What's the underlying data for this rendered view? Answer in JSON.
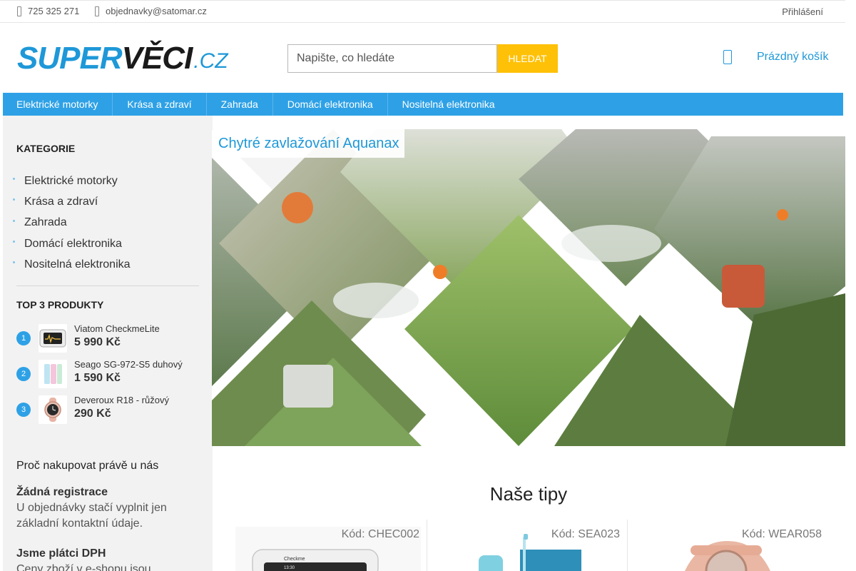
{
  "topbar": {
    "phone": "725 325 271",
    "email": "objednavky@satomar.cz",
    "login": "Přihlášení"
  },
  "logo": {
    "part1": "SUPER",
    "part2": "VĚCI",
    "part3": ".CZ"
  },
  "search": {
    "placeholder": "Napište, co hledáte",
    "button": "Hledat"
  },
  "cart": {
    "label": "Prázdný košík",
    "icon": "cart-icon"
  },
  "nav": {
    "items": [
      {
        "label": "Elektrické motorky"
      },
      {
        "label": "Krása a zdraví"
      },
      {
        "label": "Zahrada"
      },
      {
        "label": "Domácí elektronika"
      },
      {
        "label": "Nositelná elektronika"
      }
    ]
  },
  "sidebar": {
    "categories_title": "Kategorie",
    "categories": [
      {
        "label": "Elektrické motorky"
      },
      {
        "label": "Krása a zdraví"
      },
      {
        "label": "Zahrada"
      },
      {
        "label": "Domácí elektronika"
      },
      {
        "label": "Nositelná elektronika"
      }
    ],
    "top_title": "TOP 3 produkty",
    "top": [
      {
        "rank": "1",
        "name": "Viatom CheckmeLite",
        "price": "5 990 Kč"
      },
      {
        "rank": "2",
        "name": "Seago SG-972-S5 duhový",
        "price": "1 590 Kč"
      },
      {
        "rank": "3",
        "name": "Deveroux R18 - růžový",
        "price": "290 Kč"
      }
    ],
    "why_title": "Proč nakupovat právě u nás",
    "why": [
      {
        "heading": "Žádná registrace",
        "text": "U objednávky stačí vyplnit jen základní kontaktní údaje."
      },
      {
        "heading": "Jsme plátci DPH",
        "text": "Ceny zboží v e-shopu jsou"
      }
    ]
  },
  "banner": {
    "caption": "Chytré zavlažování Aquanax"
  },
  "tips": {
    "title": "Naše tipy",
    "products": [
      {
        "code": "Kód: CHEC002",
        "screen_text": "Checkme",
        "screen_time": "13:30"
      },
      {
        "code": "Kód: SEA023"
      },
      {
        "code": "Kód: WEAR058"
      }
    ]
  },
  "colors": {
    "accent": "#1e98d8",
    "nav": "#2ea1e6",
    "search_button": "#ffc107",
    "sidebar_bg": "#f2f2f2"
  }
}
